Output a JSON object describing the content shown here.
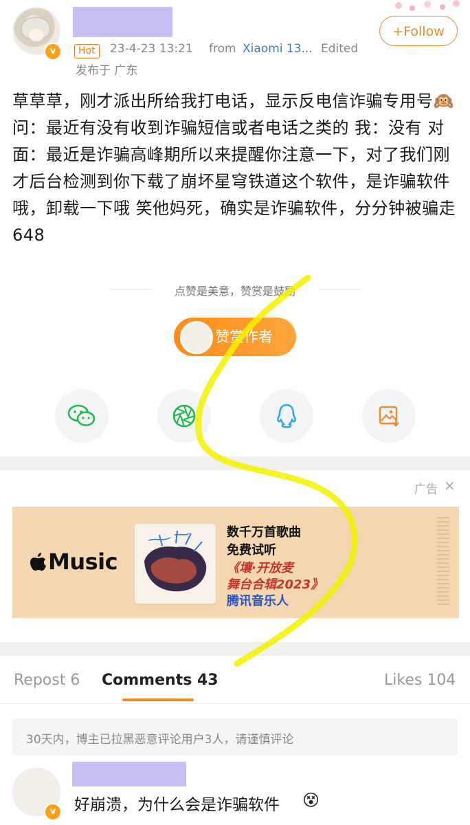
{
  "header": {
    "hot_badge": "Hot",
    "time": "23-4-23 13:21",
    "from": "from",
    "device": "Xiaomi 13...",
    "edited": "Edited",
    "location": "发布于 广东",
    "follow_label": "+Follow"
  },
  "post": {
    "text": "草草草，刚才派出所给我打电话，显示反电信诈骗专用号🙉 问：最近有没有收到诈骗短信或者电话之类的 我：没有 对面：最近是诈骗高峰期所以来提醒你注意一下，对了我们刚才后台检测到你下载了崩坏星穹铁道这个软件，是诈骗软件哦，卸载一下哦 笑他妈死，确实是诈骗软件，分分钟被骗走648"
  },
  "reward": {
    "hint": "点赞是美意，赞赏是鼓励",
    "button_label": "赞赏作者"
  },
  "share": {
    "icons": [
      "wechat-icon",
      "moments-icon",
      "qq-icon",
      "save-image-icon"
    ]
  },
  "ad": {
    "label": "广告",
    "close": "×",
    "brand": "Music",
    "line1": "数千万首歌曲",
    "line2": "免费试听",
    "line3": "《壤·开放麦",
    "line4": "舞台合辑2023》",
    "line5": "腾讯音乐人"
  },
  "tabs": {
    "repost": "Repost 6",
    "comments": "Comments 43",
    "likes": "Likes 104"
  },
  "notice": "30天内，博主已拉黑恶意评论用户3人，请谨慎评论",
  "comment": {
    "text": "好崩溃，为什么会是诈骗软件",
    "emoji": "😵"
  },
  "colors": {
    "accent": "#f08a2e",
    "link": "#4a7ab8",
    "verify": "#f7a21b",
    "highlight_scribble": "#f4f200",
    "redaction": "#c9bff2"
  }
}
